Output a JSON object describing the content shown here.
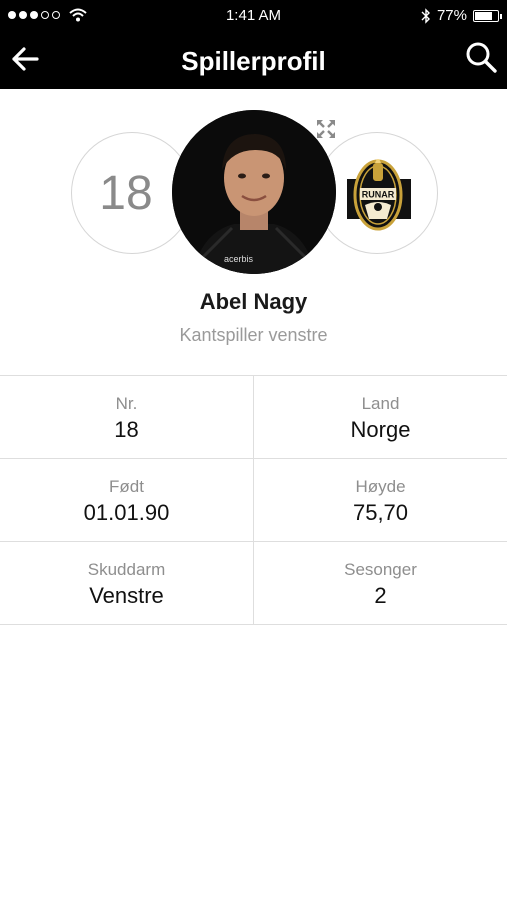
{
  "status_bar": {
    "time": "1:41 AM",
    "battery_percent": "77%",
    "battery_level": 0.77,
    "signal_dots_filled": 3,
    "signal_dots_total": 5,
    "icons": [
      "signal-dots-icon",
      "wifi-icon",
      "bluetooth-icon",
      "battery-icon"
    ]
  },
  "nav": {
    "title": "Spillerprofil",
    "back_icon": "arrow-left-icon",
    "search_icon": "search-icon"
  },
  "player": {
    "number": "18",
    "name": "Abel Nagy",
    "position": "Kantspiller venstre",
    "photo_icon": "player-photo",
    "club_logo_icon": "club-logo",
    "club_logo_text": "RUNAR",
    "expand_icon": "expand-icon"
  },
  "stats": [
    [
      {
        "label": "Nr.",
        "value": "18"
      },
      {
        "label": "Land",
        "value": "Norge"
      }
    ],
    [
      {
        "label": "Født",
        "value": "01.01.90"
      },
      {
        "label": "Høyde",
        "value": "75,70"
      }
    ],
    [
      {
        "label": "Skuddarm",
        "value": "Venstre"
      },
      {
        "label": "Sesonger",
        "value": "2"
      }
    ]
  ],
  "colors": {
    "bar_background": "#000000",
    "bar_text": "#ffffff",
    "divider": "#dedede",
    "muted_text": "#8e8e8e",
    "club_gold": "#c9a23a"
  }
}
